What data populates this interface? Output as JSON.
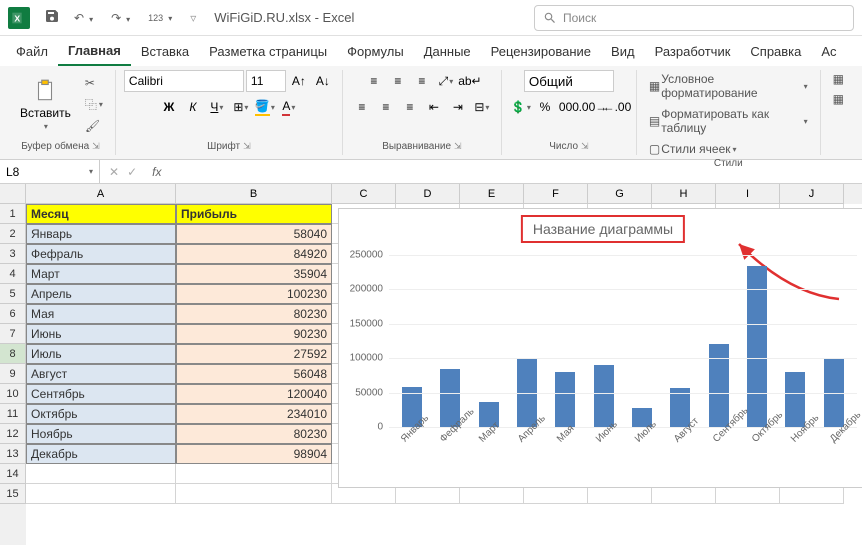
{
  "titlebar": {
    "filename": "WiFiGiD.RU.xlsx - Excel",
    "search_placeholder": "Поиск"
  },
  "ribbon_tabs": [
    "Файл",
    "Главная",
    "Вставка",
    "Разметка страницы",
    "Формулы",
    "Данные",
    "Рецензирование",
    "Вид",
    "Разработчик",
    "Справка",
    "Ас"
  ],
  "ribbon": {
    "clipboard": {
      "paste": "Вставить",
      "label": "Буфер обмена"
    },
    "font": {
      "name": "Calibri",
      "size": "11",
      "label": "Шрифт"
    },
    "align": {
      "label": "Выравнивание"
    },
    "number": {
      "format": "Общий",
      "label": "Число"
    },
    "styles": {
      "cond_fmt": "Условное форматирование",
      "as_table": "Форматировать как таблицу",
      "cell_styles": "Стили ячеек",
      "label": "Стили"
    }
  },
  "name_box": "L8",
  "columns": [
    "A",
    "B",
    "C",
    "D",
    "E",
    "F",
    "G",
    "H",
    "I",
    "J"
  ],
  "table": {
    "headers": [
      "Месяц",
      "Прибыль"
    ],
    "rows": [
      {
        "month": "Январь",
        "value": "58040"
      },
      {
        "month": "Фефраль",
        "value": "84920"
      },
      {
        "month": "Март",
        "value": "35904"
      },
      {
        "month": "Апрель",
        "value": "100230"
      },
      {
        "month": "Мая",
        "value": "80230"
      },
      {
        "month": "Июнь",
        "value": "90230"
      },
      {
        "month": "Июль",
        "value": "27592"
      },
      {
        "month": "Август",
        "value": "56048"
      },
      {
        "month": "Сентябрь",
        "value": "120040"
      },
      {
        "month": "Октябрь",
        "value": "234010"
      },
      {
        "month": "Ноябрь",
        "value": "80230"
      },
      {
        "month": "Декабрь",
        "value": "98904"
      }
    ]
  },
  "chart_data": {
    "type": "bar",
    "title": "Название диаграммы",
    "categories": [
      "Январь",
      "Фефраль",
      "Март",
      "Апрель",
      "Мая",
      "Июнь",
      "Июль",
      "Август",
      "Сентябрь",
      "Октябрь",
      "Ноябрь",
      "Декабрь"
    ],
    "values": [
      58040,
      84920,
      35904,
      100230,
      80230,
      90230,
      27592,
      56048,
      120040,
      234010,
      80230,
      98904
    ],
    "ylim": [
      0,
      250000
    ],
    "yticks": [
      0,
      50000,
      100000,
      150000,
      200000,
      250000
    ]
  }
}
